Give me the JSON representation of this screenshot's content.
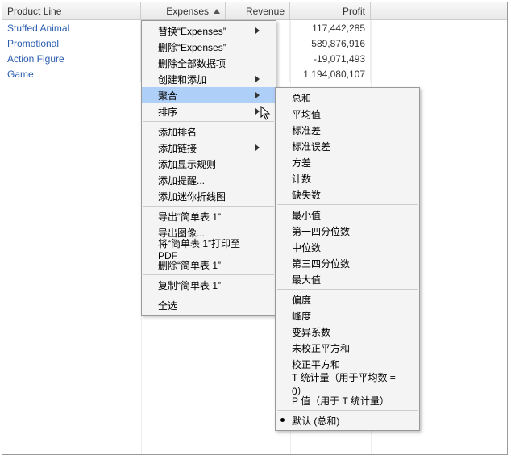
{
  "headers": {
    "product": "Product Line",
    "expenses": "Expenses",
    "revenue": "Revenue",
    "profit": "Profit"
  },
  "rows": [
    {
      "product": "Stuffed Animal",
      "profit": "117,442,285"
    },
    {
      "product": "Promotional",
      "profit": "589,876,916"
    },
    {
      "product": "Action Figure",
      "profit": "-19,071,493"
    },
    {
      "product": "Game",
      "profit": "1,194,080,107"
    }
  ],
  "sorted_column": "expenses",
  "sort_direction": "asc",
  "context_menu": {
    "replace": "替换“Expenses”",
    "delete_col": "删除“Expenses”",
    "delete_all": "删除全部数据项",
    "create_add": "创建和添加",
    "aggregate": "聚合",
    "sort": "排序",
    "add_rank": "添加排名",
    "add_link": "添加链接",
    "add_rule": "添加显示规则",
    "add_alert": "添加提醒...",
    "add_sparkline": "添加迷你折线图",
    "export_table": "导出“简单表 1”",
    "export_image": "导出图像...",
    "print_pdf": "将“简单表 1”打印至 PDF",
    "delete_table": "删除“简单表 1”",
    "copy_table": "复制“简单表 1”",
    "select_all": "全选"
  },
  "aggregate_submenu": {
    "sum": "总和",
    "mean": "平均值",
    "stddev": "标准差",
    "stderr": "标准误差",
    "variance": "方差",
    "count": "计数",
    "missing": "缺失数",
    "min": "最小值",
    "q1": "第一四分位数",
    "median": "中位数",
    "q3": "第三四分位数",
    "max": "最大值",
    "skewness": "偏度",
    "kurtosis": "峰度",
    "cv": "变异系数",
    "uss": "未校正平方和",
    "css": "校正平方和",
    "tstat": "T 统计量（用于平均数 = 0）",
    "pvalue": "P 值（用于 T 统计量）",
    "default": "默认 (总和)"
  }
}
